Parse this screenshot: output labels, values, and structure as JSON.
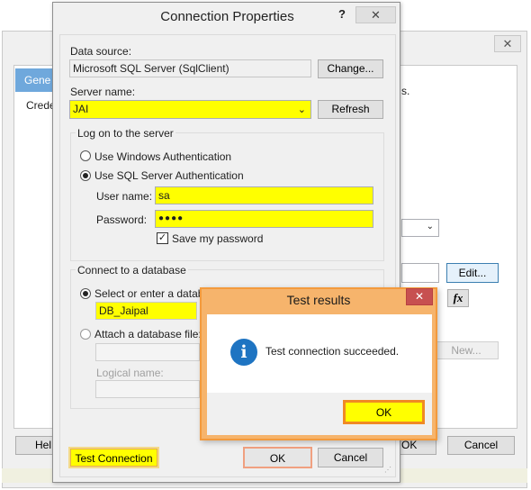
{
  "background_window": {
    "tab_general": "Gene",
    "row_credentials": "Crede",
    "suffix_text": "s.",
    "help_button": "Hel",
    "ok_fragment": "OK",
    "cancel_button": "Cancel",
    "edit_button": "Edit...",
    "fx_glyph": "fx",
    "new_button": "New..."
  },
  "dialog": {
    "title": "Connection Properties",
    "help_glyph": "?",
    "data_source_label": "Data source:",
    "data_source_value": "Microsoft SQL Server (SqlClient)",
    "change_button": "Change...",
    "server_name_label": "Server name:",
    "server_name_value": "JAI",
    "refresh_button": "Refresh",
    "logon_group": "Log on to the server",
    "windows_auth": "Use Windows Authentication",
    "sql_auth": "Use SQL Server Authentication",
    "username_label": "User name:",
    "username_value": "sa",
    "password_label": "Password:",
    "password_value": "●●●●",
    "save_password": "Save my password",
    "connect_group": "Connect to a database",
    "select_db": "Select or enter a database name:",
    "db_value": "DB_Jaipal",
    "attach_db": "Attach a database file:",
    "logical_name_label": "Logical name:",
    "test_button": "Test Connection",
    "ok_button": "OK",
    "cancel_button": "Cancel"
  },
  "test_results": {
    "title": "Test results",
    "message": "Test connection succeeded.",
    "ok_button": "OK",
    "info_glyph": "i"
  },
  "colors": {
    "highlight": "#ffff00",
    "accent_orange": "#f08a24",
    "close_red": "#c75050",
    "info_blue": "#1e74c2"
  }
}
